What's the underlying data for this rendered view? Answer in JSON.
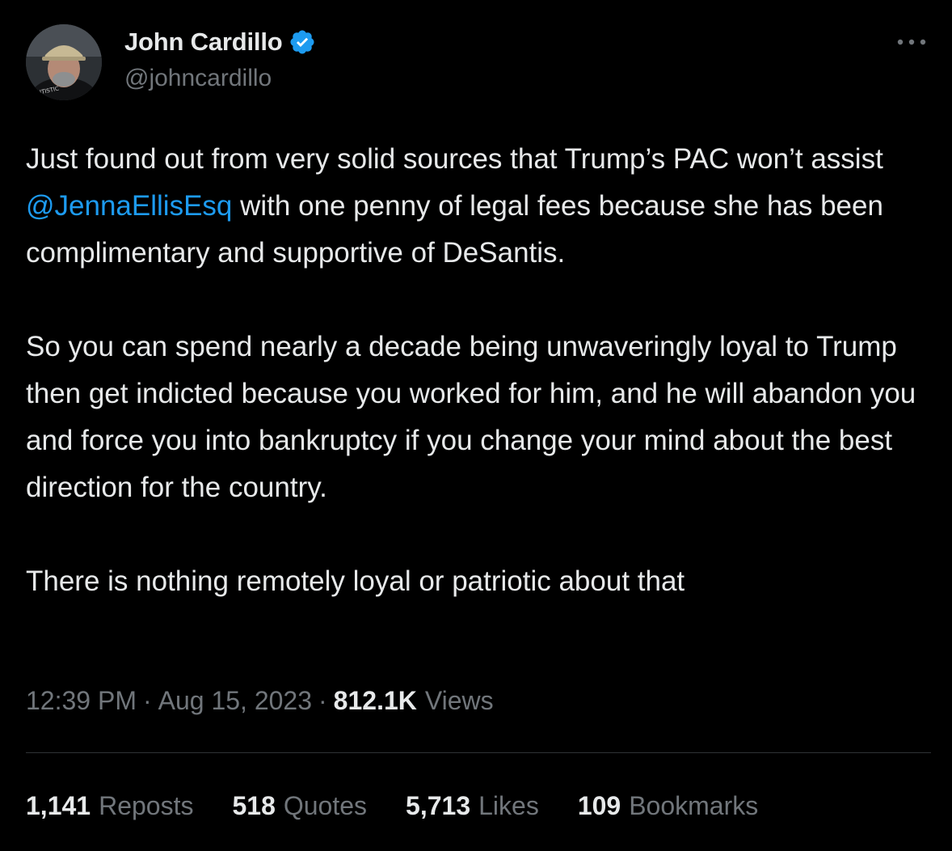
{
  "author": {
    "display_name": "John Cardillo",
    "handle": "@johncardillo",
    "verified_icon": "verified-badge-icon",
    "avatar": "avatar"
  },
  "more_icon": "more-icon",
  "tweet": {
    "para1_before": "Just found out from very solid sources that Trump’s PAC won’t assist ",
    "mention": "@JennaEllisEsq",
    "para1_after": " with one penny of legal fees because she has been complimentary and supportive of DeSantis.",
    "para2": "So you can spend nearly a decade being unwaveringly loyal to Trump then get indicted because you worked for him, and he will abandon you and force you into bankruptcy if you change your mind about the best direction for the country.",
    "para3": "There is nothing remotely loyal or patriotic about that"
  },
  "meta": {
    "time": "12:39 PM",
    "separator": "·",
    "date": "Aug 15, 2023",
    "views_count": "812.1K",
    "views_label": "Views"
  },
  "stats": [
    {
      "count": "1,141",
      "label": "Reposts"
    },
    {
      "count": "518",
      "label": "Quotes"
    },
    {
      "count": "5,713",
      "label": "Likes"
    },
    {
      "count": "109",
      "label": "Bookmarks"
    }
  ],
  "colors": {
    "background": "#000000",
    "text": "#e7e9ea",
    "secondary": "#71767b",
    "accent": "#1d9bf0",
    "divider": "#2f3336"
  }
}
